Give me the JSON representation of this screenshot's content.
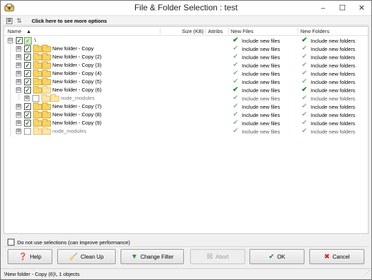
{
  "window": {
    "title": "File & Folder Selection : test",
    "minimize": "–",
    "maximize": "☐",
    "close": "✕"
  },
  "options": {
    "expand_collapse": "⊞",
    "sort": "⇅",
    "more_options_label": "Click here to see more options"
  },
  "columns": {
    "name": "Name",
    "sort_arrow": "▲",
    "size": "Size (KB)",
    "attribs": "Attribs",
    "new_files": "New Files",
    "new_folders": "New Folders"
  },
  "tree": {
    "root": {
      "name": "\\",
      "expander": "⊟",
      "checked": true,
      "new_files": "Include new files",
      "new_folders": "Include new folders"
    },
    "rows": [
      {
        "name": "New folder - Copy",
        "expander": "⊞",
        "checked": true,
        "new_files": "Include new files",
        "new_folders": "Include new folders"
      },
      {
        "name": "New folder - Copy (2)",
        "expander": "⊞",
        "checked": true,
        "new_files": "Include new files",
        "new_folders": "Include new folders"
      },
      {
        "name": "New folder - Copy (3)",
        "expander": "⊞",
        "checked": true,
        "new_files": "Include new files",
        "new_folders": "Include new folders"
      },
      {
        "name": "New folder - Copy (4)",
        "expander": "⊞",
        "checked": true,
        "new_files": "Include new files",
        "new_folders": "Include new folders"
      },
      {
        "name": "New folder - Copy (5)",
        "expander": "⊞",
        "checked": true,
        "new_files": "Include new files",
        "new_folders": "Include new folders"
      },
      {
        "name": "New folder - Copy (6)",
        "expander": "⊟",
        "checked": true,
        "new_files": "Include new files",
        "new_folders": "Include new folders"
      },
      {
        "name": "node_modules",
        "expander": "⊞",
        "checked": false,
        "new_files": "Include new files",
        "new_folders": "Include new folders"
      },
      {
        "name": "New folder - Copy (7)",
        "expander": "⊞",
        "checked": true,
        "new_files": "Include new files",
        "new_folders": "Include new folders"
      },
      {
        "name": "New folder - Copy (8)",
        "expander": "⊞",
        "checked": true,
        "new_files": "Include new files",
        "new_folders": "Include new folders"
      },
      {
        "name": "New folder - Copy (9)",
        "expander": "⊞",
        "checked": true,
        "new_files": "Include new files",
        "new_folders": "Include new folders"
      },
      {
        "name": "node_modules",
        "expander": "⊞",
        "checked": false,
        "new_files": "Include new files",
        "new_folders": "Include new folders"
      }
    ]
  },
  "performance_option": {
    "label": "Do not use selections (can improve performance)",
    "checked": false
  },
  "buttons": {
    "help": "Help",
    "clean_up": "Clean Up",
    "change_filter": "Change Filter",
    "abort": "Abort",
    "ok": "OK",
    "cancel": "Cancel"
  },
  "status": {
    "text": "\\New folder - Copy (6)\\, 1 objects"
  },
  "colors": {
    "check_green": "#1f8a1f",
    "folder_yellow": "#f6d365",
    "window_bg": "#f0f0f0"
  }
}
